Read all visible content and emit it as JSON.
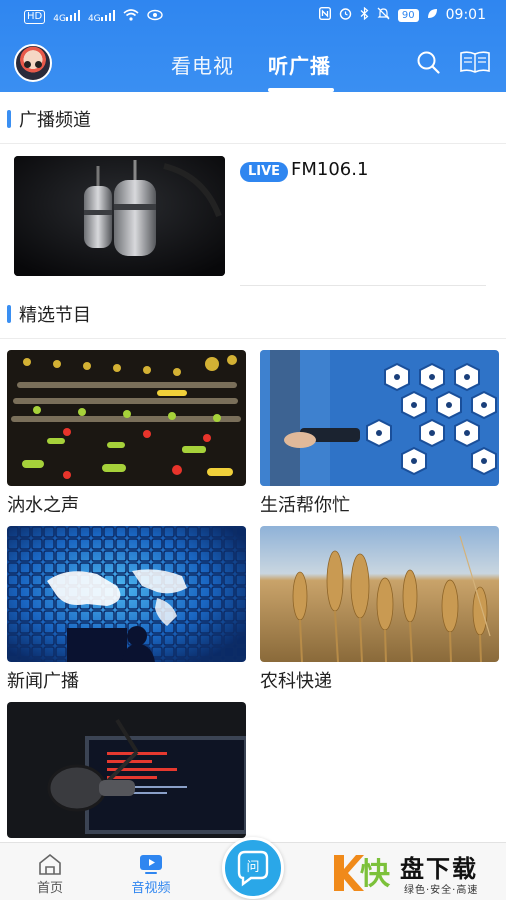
{
  "statusbar": {
    "left": [
      "HD",
      "4G",
      "4G"
    ],
    "battery": "90",
    "time": "09:01"
  },
  "nav": {
    "tabs": [
      {
        "label": "看电视",
        "active": false
      },
      {
        "label": "听广播",
        "active": true
      }
    ],
    "icons": [
      "avatar",
      "search-icon",
      "news-icon"
    ]
  },
  "sections": {
    "channels_title": "广播频道",
    "programs_title": "精选节目"
  },
  "channel": {
    "badge": "LIVE",
    "name": "FM106.1"
  },
  "programs": [
    {
      "title": "汭水之声"
    },
    {
      "title": "生活帮你忙"
    },
    {
      "title": "新闻广播"
    },
    {
      "title": "农科快递"
    },
    {
      "title": ""
    }
  ],
  "bottom_nav": {
    "items": [
      {
        "label": "首页",
        "icon": "home-icon",
        "active": false
      },
      {
        "label": "音视频",
        "icon": "video-icon",
        "active": true
      },
      {
        "label": "问",
        "icon": "ask-icon",
        "active": false
      }
    ]
  },
  "watermark": {
    "glyph": "快",
    "title": "盘下载",
    "subtitle": "绿色·安全·高速"
  },
  "colors": {
    "accent": "#2f86f0",
    "fab": "#2aa7e8",
    "watermark_green": "#7cc13a"
  }
}
